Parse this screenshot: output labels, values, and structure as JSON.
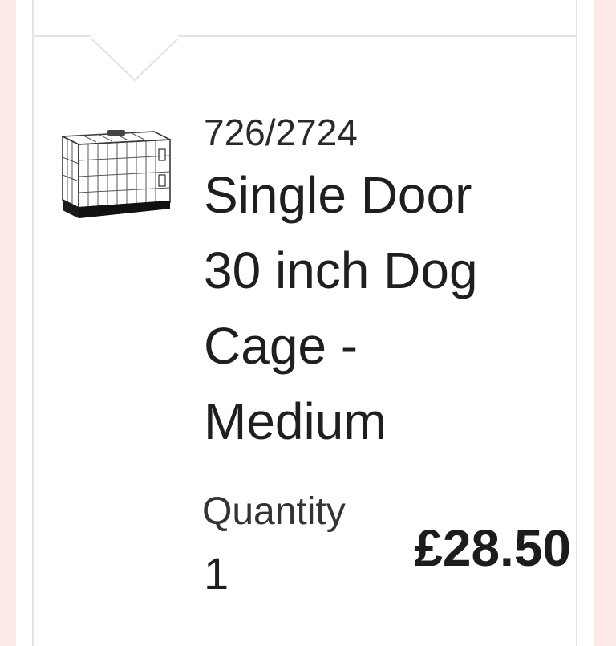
{
  "order_item": {
    "product_code": "726/2724",
    "title": "Single Door 30 inch Dog Cage - Medium",
    "quantity_label": "Quantity",
    "quantity": "1",
    "price": "£28.50"
  },
  "icons": {
    "expand_indicator": "chevron-down-icon",
    "product_image": "dog-cage-icon"
  }
}
